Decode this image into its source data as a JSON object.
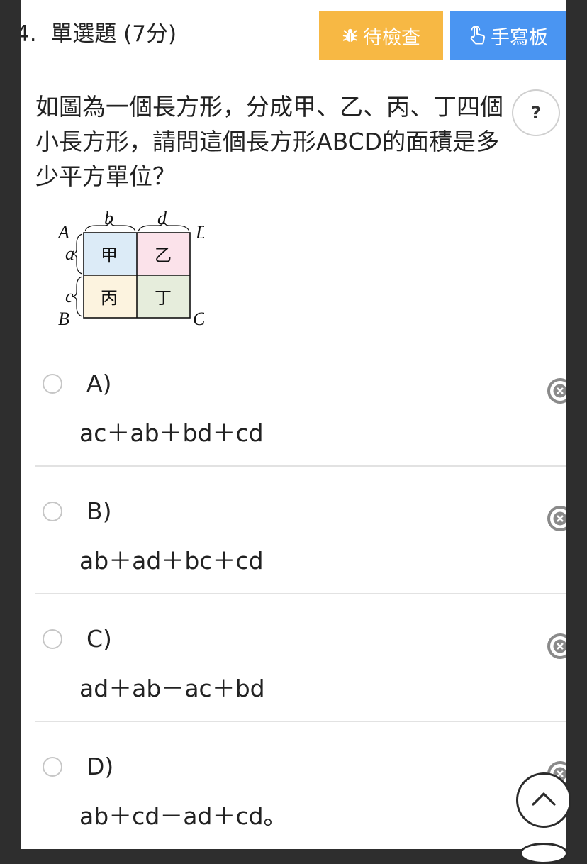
{
  "question": {
    "number": "4.",
    "type_label": "單選題",
    "points": "(7分)",
    "text": "如圖為一個長方形，分成甲、乙、丙、丁四個小長方形，請問這個長方形ABCD的面積是多少平方單位？"
  },
  "toolbar": {
    "review_label": "待檢查",
    "handwriting_label": "手寫板",
    "help_label": "?"
  },
  "figure": {
    "vertex_a": "A",
    "vertex_b": "B",
    "vertex_c": "C",
    "vertex_d": "D",
    "side_a": "a",
    "side_b": "b",
    "side_c": "c",
    "side_d": "d",
    "cell_jia": "甲",
    "cell_yi": "乙",
    "cell_bing": "丙",
    "cell_ding": "丁",
    "colors": {
      "jia": "#dcebf7",
      "yi": "#fbe2ea",
      "bing": "#fcf3df",
      "ding": "#e6eddc"
    }
  },
  "options": [
    {
      "letter": "A)",
      "expression": "ac＋ab＋bd＋cd"
    },
    {
      "letter": "B)",
      "expression": "ab＋ad＋bc＋cd"
    },
    {
      "letter": "C)",
      "expression": "ad＋ab－ac＋bd"
    },
    {
      "letter": "D)",
      "expression": "ab＋cd－ad＋cd。"
    }
  ],
  "colors": {
    "review_button": "#f7b844",
    "handwriting_button": "#4a95f2"
  },
  "icons": {
    "review": "bug-icon",
    "handwriting": "pointer-hand-icon",
    "eliminate": "close-circle-icon",
    "scroll_top": "chevron-up-icon"
  }
}
